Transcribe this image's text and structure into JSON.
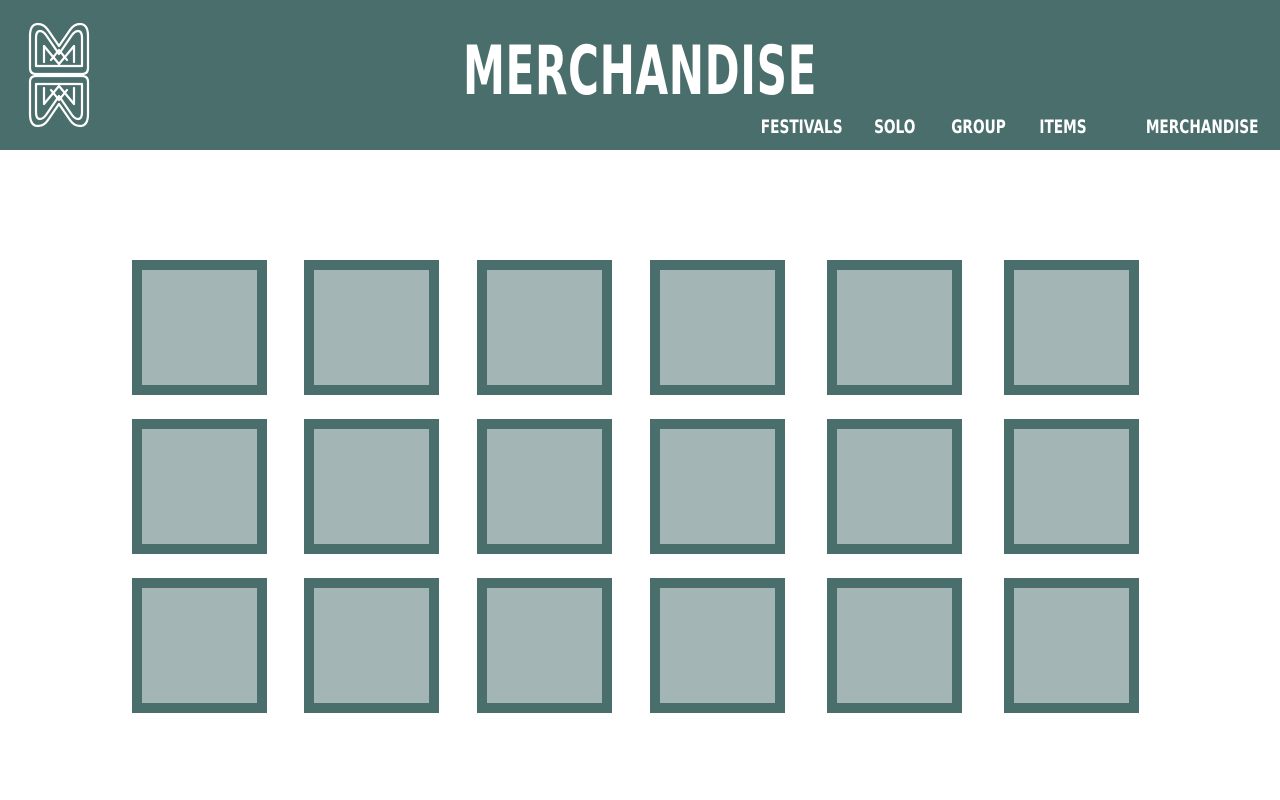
{
  "header": {
    "title": "MERCHANDISE",
    "background_color": "#4a6e6b",
    "logo_icon": "mw-monogram-logo"
  },
  "nav": {
    "items": [
      {
        "label": "FESTIVALS"
      },
      {
        "label": "SOLO"
      },
      {
        "label": "GROUP"
      },
      {
        "label": "ITEMS"
      },
      {
        "label": "MERCHANDISE"
      }
    ]
  },
  "grid": {
    "rows": 3,
    "columns": 6,
    "tile_border_color": "#4a6e6b",
    "tile_fill_color": "#a3b5b4"
  }
}
